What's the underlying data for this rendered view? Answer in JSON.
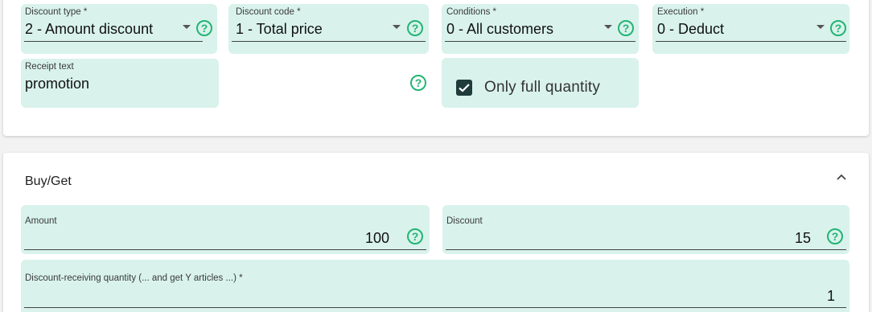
{
  "top_section": {
    "discount_type": {
      "label": "Discount type *",
      "value": "2 - Amount discount",
      "help": "?"
    },
    "discount_code": {
      "label": "Discount code *",
      "value": "1 - Total price",
      "help": "?"
    },
    "conditions": {
      "label": "Conditions *",
      "value": "0 - All customers",
      "help": "?"
    },
    "execution": {
      "label": "Execution *",
      "value": "0 - Deduct",
      "help": "?"
    },
    "receipt_text": {
      "label": "Receipt text",
      "value": "promotion",
      "help": "?"
    },
    "only_full_quantity": {
      "label": "Only full quantity",
      "checked": true
    }
  },
  "buy_get": {
    "title": "Buy/Get",
    "amount": {
      "label": "Amount",
      "value": "100",
      "help": "?"
    },
    "discount": {
      "label": "Discount",
      "value": "15",
      "help": "?"
    },
    "receiving_quantity": {
      "label": "Discount-receiving quantity (... and get Y articles ...) *",
      "value": "1"
    }
  },
  "colors": {
    "field_bg": "#d9f2ec",
    "accent": "#22b573",
    "checkbox": "#1f3b3b"
  }
}
